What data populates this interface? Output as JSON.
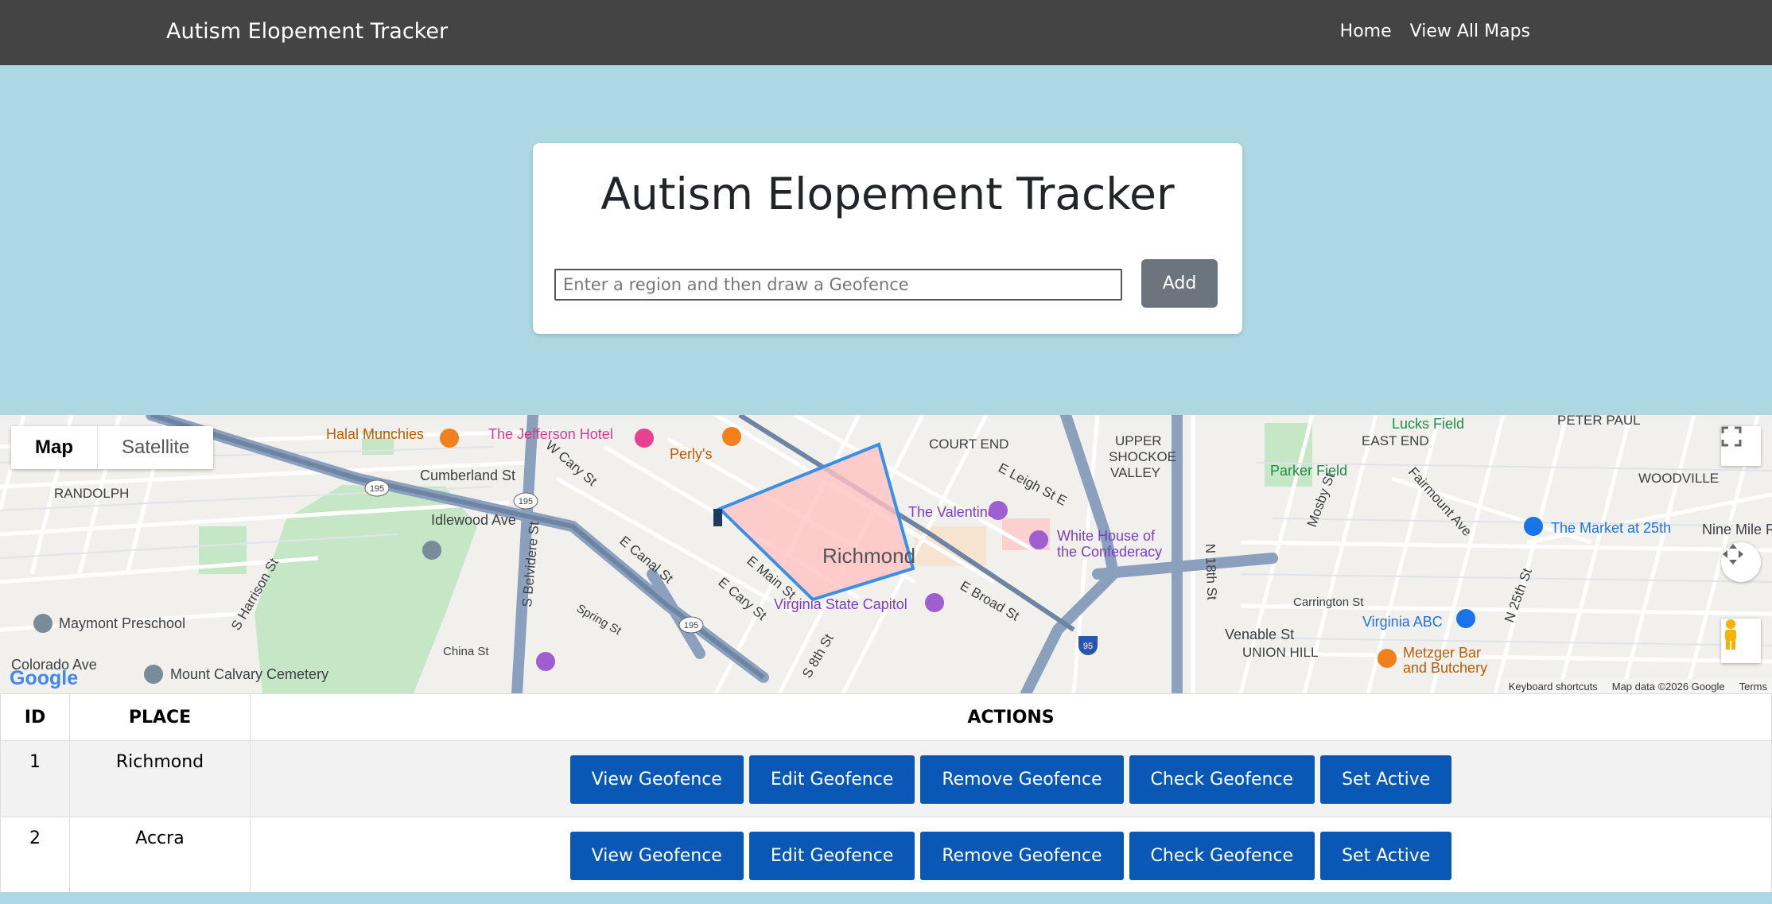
{
  "navbar": {
    "brand": "Autism Elopement Tracker",
    "links": [
      "Home",
      "View All Maps"
    ]
  },
  "card": {
    "title": "Autism Elopement Tracker",
    "input_placeholder": "Enter a region and then draw a Geofence",
    "input_value": "",
    "add_label": "Add"
  },
  "map": {
    "types": [
      "Map",
      "Satellite"
    ],
    "active_type": "Map",
    "center_label": "Richmond",
    "labels": {
      "halal": "Halal Munchies",
      "jefferson": "The Jefferson Hotel",
      "perlys": "Perly's",
      "court_end": "COURT END",
      "upper1": "UPPER",
      "upper2": "SHOCKOE",
      "upper3": "VALLEY",
      "east_end": "EAST END",
      "peter_paul": "PETER PAUL",
      "woodville": "WOODVILLE",
      "lucks": "Lucks Field",
      "parker": "Parker Field",
      "market": "The Market at 25th",
      "randolph": "RANDOLPH",
      "cumberland": "Cumberland St",
      "idlewood": "Idlewood Ave",
      "valentine": "The Valentine",
      "whitehouse1": "White House of",
      "whitehouse2": "the Confederacy",
      "capitol": "Virginia State Capitol",
      "maymont": "Maymont Preschool",
      "colorado": "Colorado Ave",
      "calvary": "Mount Calvary Cemetery",
      "china": "China St",
      "venable": "Venable St",
      "union": "UNION HILL",
      "vaabc": "Virginia ABC",
      "metzger1": "Metzger Bar",
      "metzger2": "and Butchery",
      "nine": "Nine Mile R",
      "carrington": "Carrington St",
      "eleigh": "E Leigh St E",
      "ebroad": "E Broad St",
      "emain": "E Main St",
      "ecary": "E Cary St",
      "ecanal": "E Canal St",
      "wcary": "W Cary St",
      "sharrison": "S Harrison St",
      "sbelvidere": "S Belvidere St",
      "n18": "N 18th St",
      "n25": "N 25th St",
      "mosby": "Mosby St",
      "fairmount": "Fairmount Ave",
      "spring": "Spring St",
      "s8": "S 8th St",
      "i195a": "195",
      "i195b": "195",
      "i195c": "195",
      "i95": "95"
    },
    "footer": {
      "shortcuts": "Keyboard shortcuts",
      "data": "Map data ©2026 Google",
      "terms": "Terms"
    },
    "logo": "Google",
    "geofence_color": "#3a8fe6",
    "geofence_fill": "#ffc2c2"
  },
  "table": {
    "headers": [
      "ID",
      "PLACE",
      "ACTIONS"
    ],
    "rows": [
      {
        "id": "1",
        "place": "Richmond"
      },
      {
        "id": "2",
        "place": "Accra"
      }
    ],
    "actions": [
      "View Geofence",
      "Edit Geofence",
      "Remove Geofence",
      "Check Geofence",
      "Set Active"
    ]
  }
}
